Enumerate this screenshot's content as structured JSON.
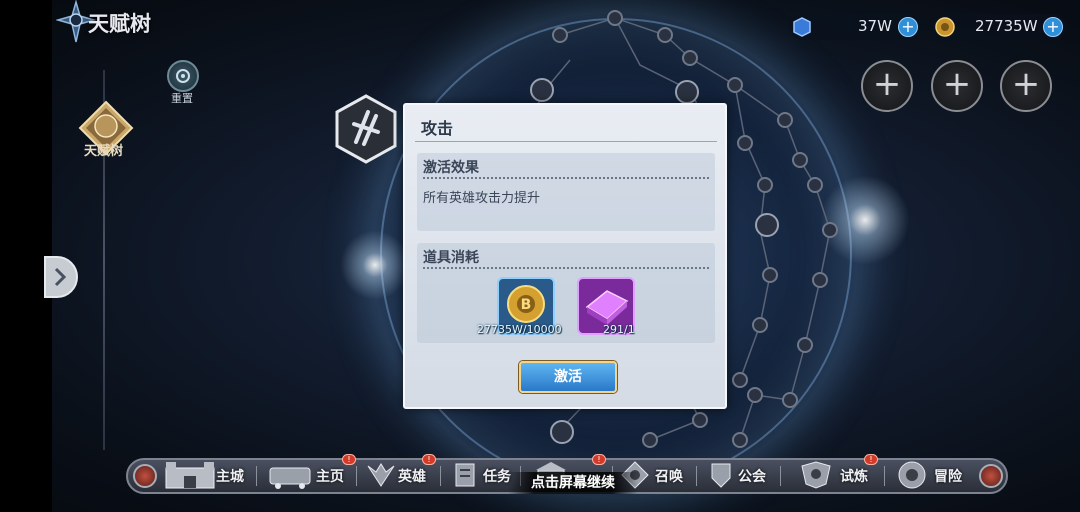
{
  "header": {
    "title": "天赋树"
  },
  "sidebar": {
    "reset_label": "重置",
    "tree_label": "天赋树"
  },
  "resources": [
    {
      "icon": "blue-gem-icon",
      "value": "37W"
    },
    {
      "icon": "gold-coin-icon",
      "value": "27735W"
    }
  ],
  "dialog": {
    "title": "攻击",
    "effect_title": "激活效果",
    "effect_text": "所有英雄攻击力提升",
    "cost_title": "道具消耗",
    "items": [
      {
        "icon": "gold-coin-icon",
        "count": "27735W/10000"
      },
      {
        "icon": "purple-book-icon",
        "count": "291/1"
      }
    ],
    "activate_label": "激活"
  },
  "nav": {
    "items": [
      {
        "label": "主城",
        "icon": "castle-icon",
        "badge": ""
      },
      {
        "label": "主页",
        "icon": "train-icon",
        "badge": "!"
      },
      {
        "label": "英雄",
        "icon": "hero-icon",
        "badge": "!"
      },
      {
        "label": "任务",
        "icon": "scroll-icon",
        "badge": ""
      },
      {
        "label": "",
        "icon": "shop-icon",
        "badge": "!"
      },
      {
        "label": "召唤",
        "icon": "summon-icon",
        "badge": ""
      },
      {
        "label": "公会",
        "icon": "guild-icon",
        "badge": ""
      },
      {
        "label": "试炼",
        "icon": "trial-icon",
        "badge": "!"
      },
      {
        "label": "冒险",
        "icon": "adventure-icon",
        "badge": ""
      }
    ],
    "continue_text": "点击屏幕继续"
  },
  "colors": {
    "accent": "#2f8fd8",
    "button_border": "#f2d48a",
    "badge": "#d23a2a"
  }
}
